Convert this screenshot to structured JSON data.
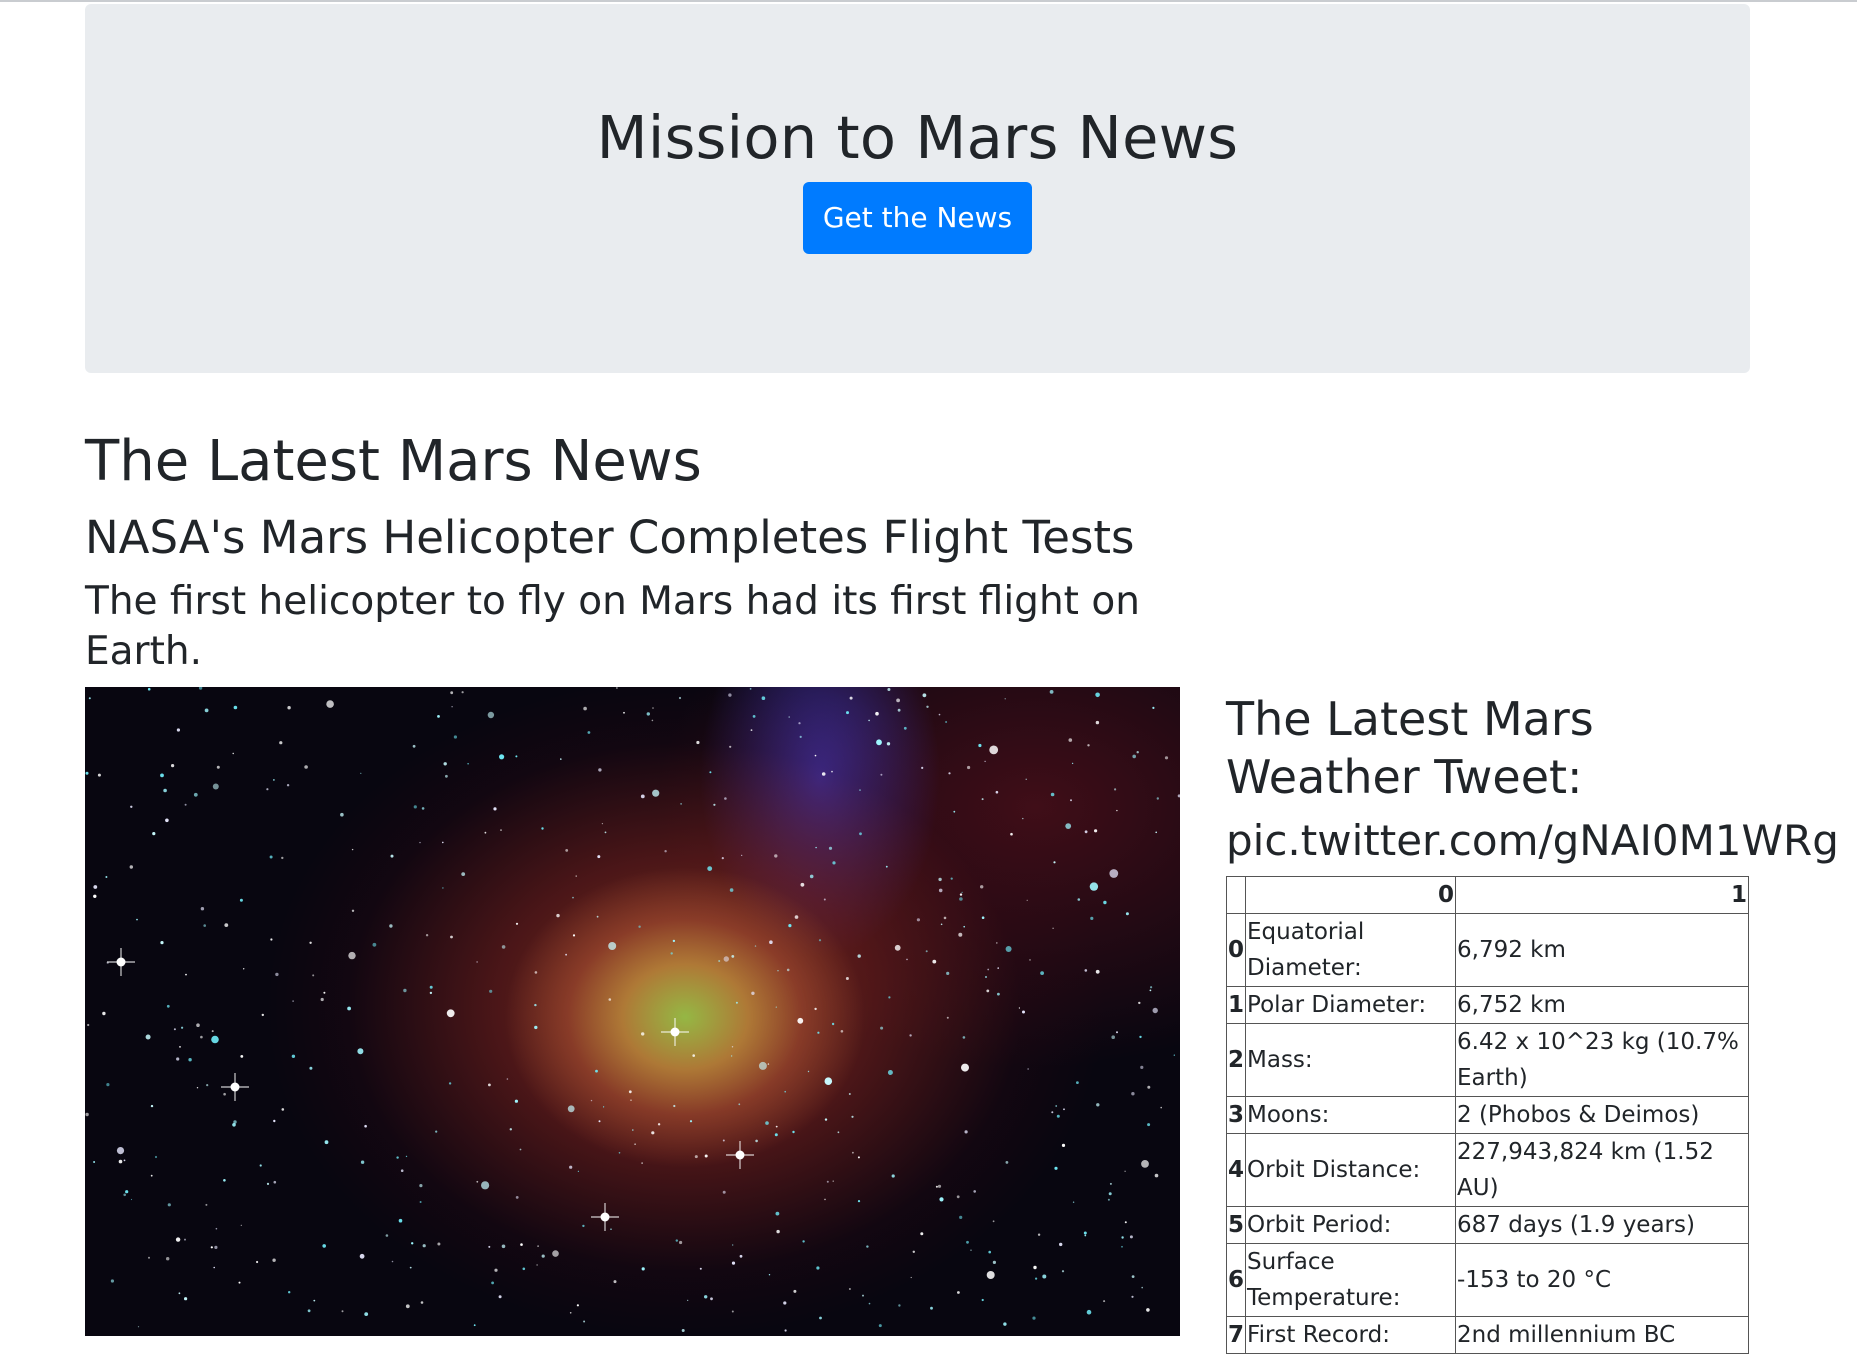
{
  "header": {
    "title": "Mission to Mars News",
    "button_label": "Get the News"
  },
  "news": {
    "section_heading": "The Latest Mars News",
    "title": "NASA's Mars Helicopter Completes Flight Tests",
    "teaser": "The first helicopter to fly on Mars had its first flight on Earth."
  },
  "featured_image": {
    "subject": "nebula-star-field"
  },
  "weather": {
    "heading": "The Latest Mars Weather Tweet:",
    "tweet": "pic.twitter.com/gNAI0M1WRg"
  },
  "facts_table": {
    "columns": [
      "",
      "0",
      "1"
    ],
    "rows": [
      {
        "index": "0",
        "label": "Equatorial Diameter:",
        "value": "6,792 km"
      },
      {
        "index": "1",
        "label": "Polar Diameter:",
        "value": "6,752 km"
      },
      {
        "index": "2",
        "label": "Mass:",
        "value": "6.42 x 10^23 kg (10.7% Earth)"
      },
      {
        "index": "3",
        "label": "Moons:",
        "value": "2 (Phobos & Deimos)"
      },
      {
        "index": "4",
        "label": "Orbit Distance:",
        "value": "227,943,824 km (1.52 AU)"
      },
      {
        "index": "5",
        "label": "Orbit Period:",
        "value": "687 days (1.9 years)"
      },
      {
        "index": "6",
        "label": "Surface Temperature:",
        "value": "-153 to 20 °C"
      },
      {
        "index": "7",
        "label": "First Record:",
        "value": "2nd millennium BC"
      }
    ]
  }
}
